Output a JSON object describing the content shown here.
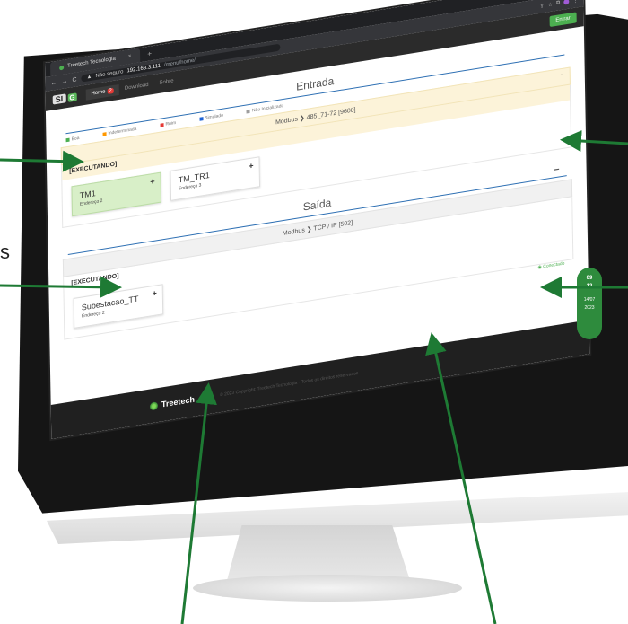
{
  "browser": {
    "tab_title": "Treetech Tecnologia",
    "tab_close": "×",
    "new_tab": "+",
    "window_controls": "⌄ – ▢ ×",
    "back": "←",
    "forward": "→",
    "reload": "C",
    "security_label": "Não seguro",
    "url_host": "192.168.3.111",
    "url_path": "/menu/home/"
  },
  "app": {
    "logo_main": "SI",
    "logo_accent": "G",
    "nav": [
      {
        "label": "Home",
        "badge": "2"
      },
      {
        "label": "Download"
      },
      {
        "label": "Sobre"
      }
    ],
    "exit_label": "Entrar"
  },
  "legend": [
    {
      "label": "Boa",
      "color": "#4caf50"
    },
    {
      "label": "Indeterminada",
      "color": "#ff9800"
    },
    {
      "label": "Ruim",
      "color": "#e53935"
    },
    {
      "label": "Simulado",
      "color": "#1e63d6"
    },
    {
      "label": "Não Inicializado",
      "color": "#9e9e9e"
    }
  ],
  "entrada": {
    "title": "Entrada",
    "collapse": "–",
    "protocol": "Modbus ❯ 485_71-72 [9600]",
    "status": "[EXECUTANDO]",
    "devices": [
      {
        "name": "TM1",
        "address": "Endereço 2",
        "state": "ok",
        "plus": "+"
      },
      {
        "name": "TM_TR1",
        "address": "Endereço 3",
        "state": "neutral",
        "plus": "+"
      }
    ]
  },
  "saida": {
    "title": "Saída",
    "collapse": "–",
    "protocol": "Modbus ❯ TCP / IP [502]",
    "status": "[EXECUTANDO]",
    "devices": [
      {
        "name": "Subestacao_TT",
        "address": "Endereço 2",
        "plus": "+"
      }
    ]
  },
  "footer": {
    "brand": "Treetech",
    "copyright": "© 2023 Copyright: Treetech Tecnologia · Todos os direitos reservados",
    "status_link": "Conectado"
  },
  "date_badge": {
    "line1": "09",
    "line2": "12",
    "line3": "14/07",
    "line4": "2023"
  },
  "edge_text": "s"
}
